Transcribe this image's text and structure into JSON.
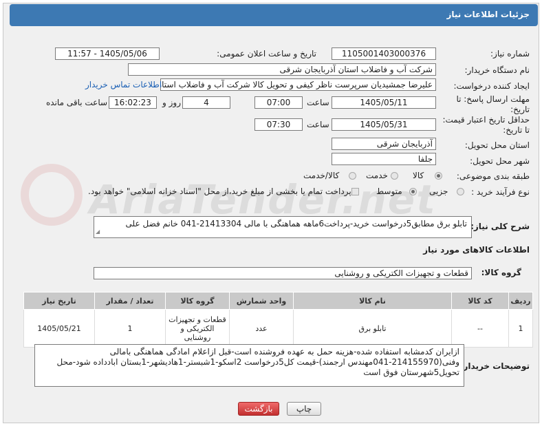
{
  "header": {
    "title": "جزئیات اطلاعات نیاز"
  },
  "form": {
    "need_number_label": "شماره نیاز:",
    "need_number": "1105001403000376",
    "announce_label": "تاریخ و ساعت اعلان عمومی:",
    "announce_value": "1405/05/06 - 11:57",
    "buyer_label": "نام دستگاه خریدار:",
    "buyer_value": "شرکت آب و فاضلاب استان آذربایجان شرقی",
    "creator_label": "ایجاد کننده درخواست:",
    "creator_value": "علیرضا جمشیدیان سرپرست ناظر کیفی و تحویل کالا شرکت آب و فاضلاب استان",
    "contact_link": "اطلاعات تماس خریدار",
    "deadline_label_1": "مهلت ارسال پاسخ: تا",
    "deadline_label_2": "تاریخ:",
    "deadline_date": "1405/05/11",
    "time_label": "ساعت",
    "deadline_time": "07:00",
    "days_value": "4",
    "days_label": "روز و",
    "remaining_time": "16:02:23",
    "remaining_label": "ساعت باقی مانده",
    "validity_label_1": "حداقل تاریخ اعتبار قیمت:",
    "validity_label_2": "تا تاریخ:",
    "validity_date": "1405/05/31",
    "validity_time_label": "ساعت",
    "validity_time": "07:30",
    "province_label": "استان محل تحویل:",
    "province_value": "آذربایجان شرقی",
    "city_label": "شهر محل تحویل:",
    "city_value": "جلفا",
    "category_label": "طبقه بندی موضوعی:",
    "category_options": [
      "کالا",
      "خدمت",
      "کالا/خدمت"
    ],
    "category_selected": "کالا",
    "process_label": "نوع فرآیند خرید :",
    "process_options": [
      "جزیی",
      "متوسط"
    ],
    "process_selected": "متوسط",
    "payment_note": "پرداخت تمام یا بخشی از مبلغ خرید،از محل \"اسناد خزانه اسلامی\" خواهد بود."
  },
  "description": {
    "label": "شرح کلی نیاز:",
    "value": "تابلو برق مطابق5درخواست خرید-پرداخت6ماهه هماهنگی با مالی 21413304-041 خانم فضل علی"
  },
  "goods_info": {
    "section_title": "اطلاعات کالاهای مورد نیاز",
    "group_label": "گروه کالا:",
    "group_value": "قطعات و تجهیزات الکتریکی و روشنایی"
  },
  "items_table": {
    "headers": [
      "ردیف",
      "کد کالا",
      "نام کالا",
      "واحد شمارش",
      "گروه کالا",
      "تعداد / مقدار",
      "تاریخ نیاز"
    ],
    "rows": [
      [
        "1",
        "--",
        "تابلو برق",
        "عدد",
        "قطعات و تجهیزات الکتریکی و روشنایی",
        "1",
        "1405/05/21"
      ]
    ]
  },
  "buyer_notes": {
    "label": "توضیحات خریدار:",
    "value": "ازایران کدمشابه استفاده شده-هزینه حمل به عهده فروشنده است-قبل ازاعلام امادگی هماهنگی بامالی وفنی(214155970-041مهندس ارجمند)-قیمت کل5درخواست 2اسکو-1شبستر-1هادیشهر-1بستان ابادداده شود-محل تحویل5شهرستان فوق است"
  },
  "buttons": {
    "print": "چاپ",
    "back": "بازگشت"
  },
  "watermark": {
    "text": "AriaTender.net"
  },
  "colors": {
    "title_bar": "#3d79b3",
    "back_button": "#d04040",
    "link": "#1a5fb4",
    "table_header": "#c9c9c9"
  }
}
